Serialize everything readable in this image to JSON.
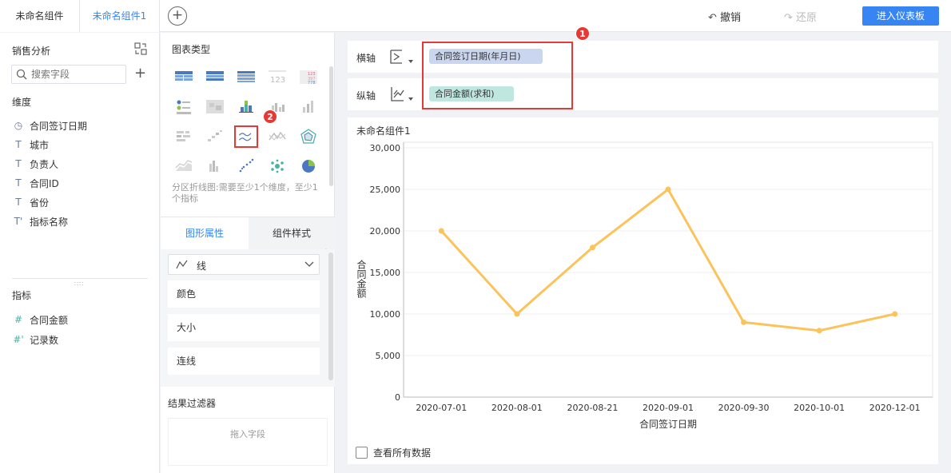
{
  "tabs": [
    {
      "label": "未命名组件"
    },
    {
      "label": "未命名组件1"
    }
  ],
  "toolbar": {
    "undo_label": "撤销",
    "redo_label": "还原",
    "enter_label": "进入仪表板"
  },
  "left": {
    "title": "销售分析",
    "search_placeholder": "搜索字段",
    "dimension_label": "维度",
    "dimensions": [
      {
        "icon": "clock-icon",
        "label": "合同签订日期"
      },
      {
        "icon": "text-icon",
        "label": "城市"
      },
      {
        "icon": "text-icon",
        "label": "负责人"
      },
      {
        "icon": "text-icon",
        "label": "合同ID"
      },
      {
        "icon": "text-icon",
        "label": "省份"
      },
      {
        "icon": "text-icon",
        "label": "指标名称"
      }
    ],
    "measure_label": "指标",
    "measures": [
      {
        "icon": "hash-icon",
        "label": "合同金额"
      },
      {
        "icon": "hash-icon",
        "label": "记录数"
      }
    ]
  },
  "middle": {
    "title": "图表类型",
    "desc": "分区折线图:需要至少1个维度，至少1个指标",
    "tab_active": "图形属性",
    "tab_other": "组件样式",
    "dropdown_value": "线",
    "props": [
      "颜色",
      "大小",
      "连线"
    ],
    "filter_title": "结果过滤器",
    "drop_placeholder": "拖入字段"
  },
  "axes": {
    "x_label": "横轴",
    "x_pill": "合同签订日期(年月日)",
    "y_label": "纵轴",
    "y_pill": "合同金额(求和)"
  },
  "badges": {
    "one": "1",
    "two": "2"
  },
  "colors": {
    "accent": "#3685f2",
    "line": "#fbc35b",
    "highlight": "#e53935"
  },
  "chart_card": {
    "title": "未命名组件1",
    "check_label": "查看所有数据"
  },
  "chart_data": {
    "type": "line",
    "categories": [
      "2020-07-01",
      "2020-08-01",
      "2020-08-21",
      "2020-09-01",
      "2020-09-30",
      "2020-10-01",
      "2020-12-01"
    ],
    "values": [
      20000,
      10000,
      18000,
      25000,
      9000,
      8000,
      10000
    ],
    "xlabel": "合同签订日期",
    "ylabel": "合同金额",
    "ylim": [
      0,
      30000
    ],
    "yticks": [
      0,
      5000,
      10000,
      15000,
      20000,
      25000,
      30000
    ],
    "ytick_labels": [
      "0",
      "5,000",
      "10,000",
      "15,000",
      "20,000",
      "25,000",
      "30,000"
    ],
    "grid": true,
    "legend": "none"
  }
}
